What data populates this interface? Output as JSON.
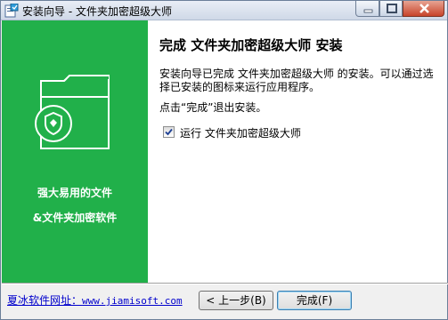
{
  "window": {
    "title": "安装向导 - 文件夹加密超级大师",
    "controls": {
      "minimize_icon": "minimize-icon",
      "maximize_icon": "maximize-icon",
      "close_icon": "close-icon"
    }
  },
  "sidebar": {
    "background": "#21b04a",
    "icon": "folder-shield-icon",
    "line1": "强大易用的文件",
    "line2": "&文件夹加密软件"
  },
  "content": {
    "heading": "完成 文件夹加密超级大师 安装",
    "paragraph1": "安装向导已完成 文件夹加密超级大师 的安装。可以通过选择已安装的图标来运行应用程序。",
    "paragraph2": "点击“完成”退出安装。",
    "run_checkbox": {
      "label": "运行 文件夹加密超级大师",
      "checked": true
    }
  },
  "footer": {
    "link_label": "夏冰软件网址：",
    "link_url": "www.jiamisoft.com",
    "back_button": "< 上一步(B)",
    "finish_button": "完成(F)"
  }
}
